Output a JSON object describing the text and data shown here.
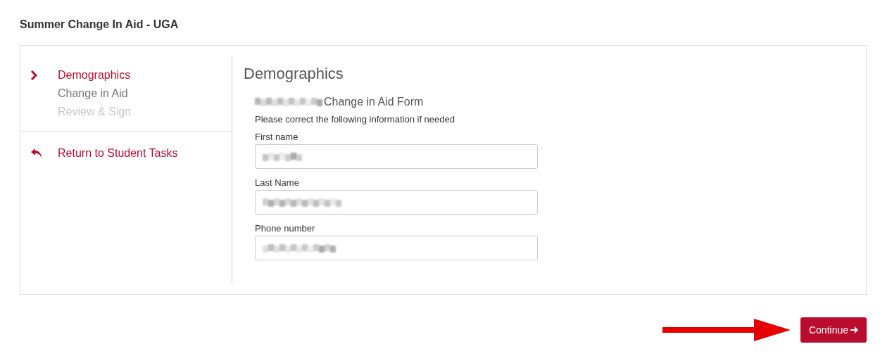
{
  "page_title": "Summer Change In Aid - UGA",
  "steps": [
    {
      "label": "Demographics",
      "selected": true,
      "disabled": false
    },
    {
      "label": "Change in Aid",
      "selected": false,
      "disabled": false
    },
    {
      "label": "Review & Sign",
      "selected": false,
      "disabled": true
    }
  ],
  "return_link": "Return to Student Tasks",
  "form": {
    "heading": "Demographics",
    "subtitle": "Change in Aid Form",
    "instruction": "Please correct the following information if needed",
    "fields": [
      {
        "label": "First name"
      },
      {
        "label": "Last Name"
      },
      {
        "label": "Phone number"
      }
    ]
  },
  "continue_button": "Continue"
}
